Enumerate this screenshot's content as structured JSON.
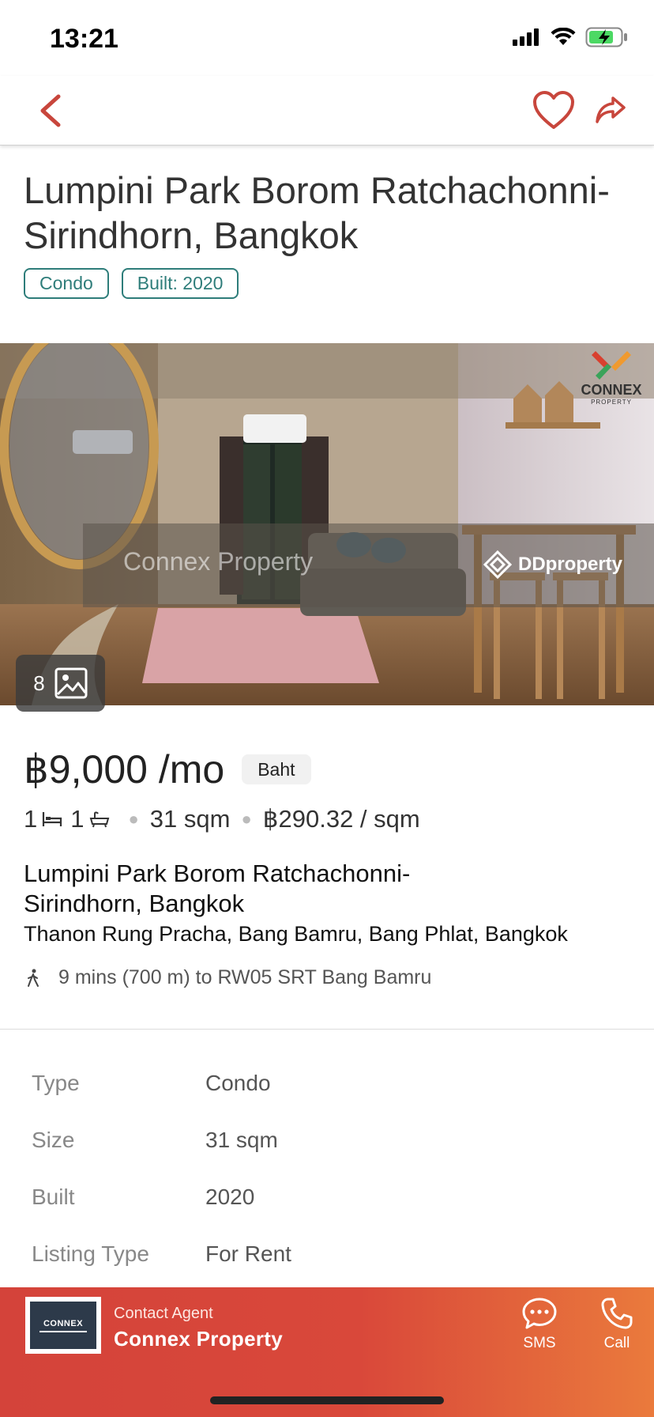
{
  "status_bar": {
    "time": "13:21"
  },
  "listing": {
    "title": "Lumpini Park Borom Ratchachonni-Sirindhorn, Bangkok",
    "tags": [
      {
        "label": "Condo"
      },
      {
        "label": "Built: 2020"
      }
    ],
    "photo": {
      "count": "8",
      "watermark": "Connex Property",
      "brand_overlay": "DDproperty",
      "logo_text": "CONNEX",
      "logo_subtext": "PROPERTY"
    },
    "price": "฿9,000 /mo",
    "currency": "Baht",
    "beds": "1",
    "baths": "1",
    "size": "31 sqm",
    "price_per_sqm": "฿290.32 / sqm",
    "address_name": "Lumpini Park Borom Ratchachonni-Sirindhorn, Bangkok",
    "address_line": "Thanon Rung Pracha, Bang Bamru, Bang Phlat, Bangkok",
    "commute": "9 mins (700 m) to RW05 SRT Bang Bamru"
  },
  "details": [
    {
      "label": "Type",
      "value": "Condo"
    },
    {
      "label": "Size",
      "value": "31 sqm"
    },
    {
      "label": "Built",
      "value": "2020"
    },
    {
      "label": "Listing Type",
      "value": "For Rent"
    }
  ],
  "contact": {
    "label": "Contact Agent",
    "agent_name": "Connex Property",
    "logo_text": "CONNEX",
    "sms_label": "SMS",
    "call_label": "Call"
  },
  "colors": {
    "accent": "#c8463c",
    "tag": "#2e7d7a",
    "contact_bar": "#d4433a"
  },
  "icons": [
    "back-chevron-icon",
    "heart-icon",
    "share-icon",
    "gallery-icon",
    "bed-icon",
    "bath-icon",
    "walk-icon",
    "sms-icon",
    "phone-icon"
  ]
}
